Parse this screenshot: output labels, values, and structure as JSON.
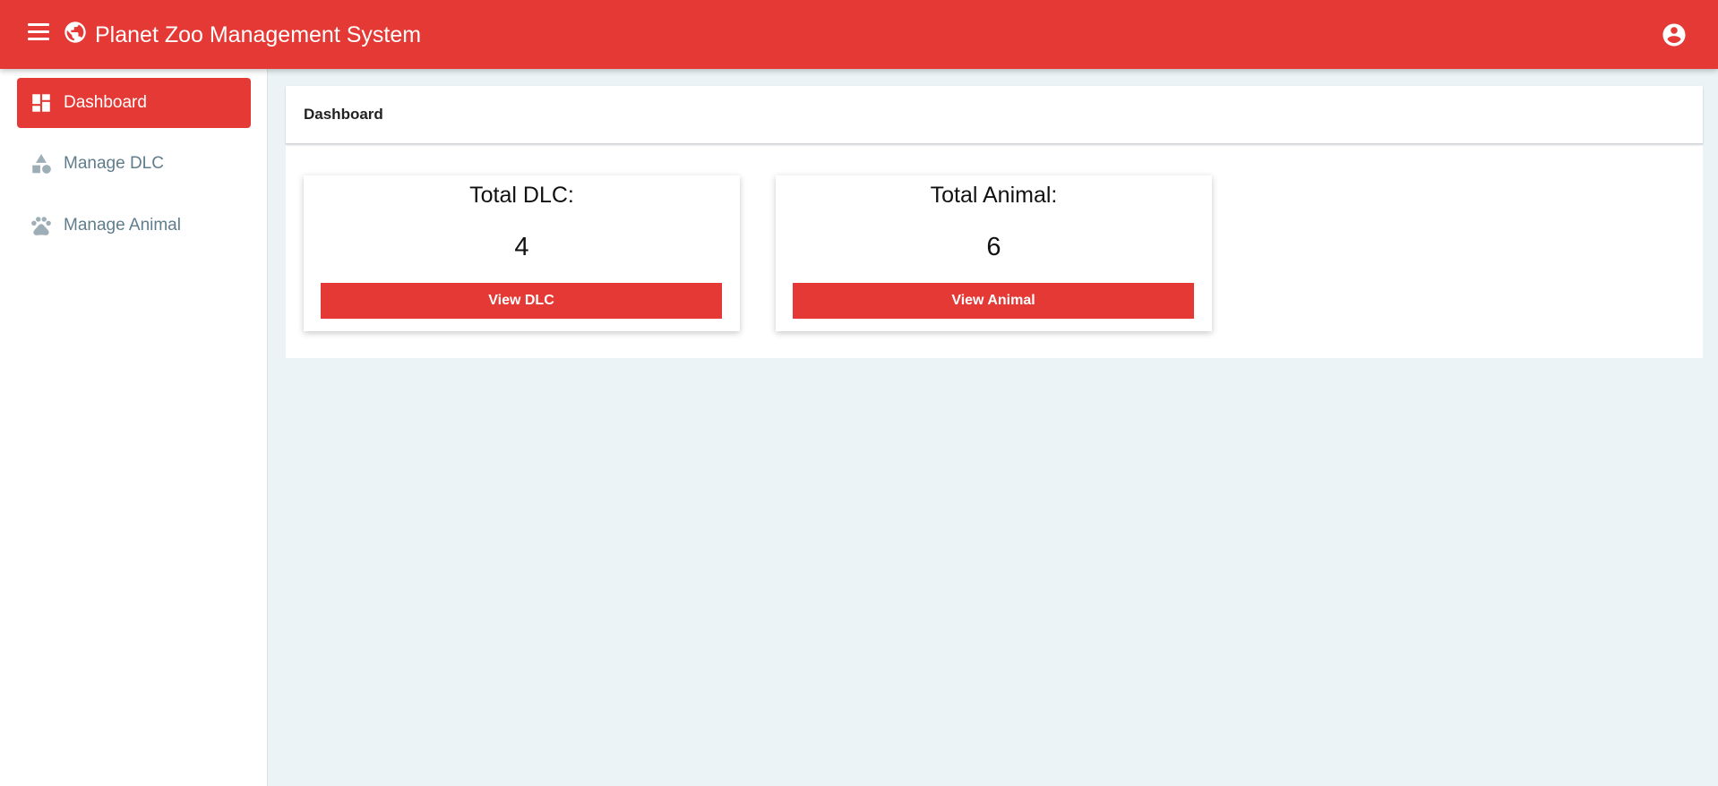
{
  "header": {
    "title": "Planet Zoo Management System",
    "menu_icon": "hamburger-menu-icon",
    "logo_icon": "globe-icon",
    "account_icon": "account-circle-icon",
    "color": "#e53935"
  },
  "sidebar": {
    "items": [
      {
        "label": "Dashboard",
        "icon": "dashboard-icon",
        "active": true
      },
      {
        "label": "Manage DLC",
        "icon": "shapes-icon",
        "active": false
      },
      {
        "label": "Manage Animal",
        "icon": "paw-icon",
        "active": false
      }
    ]
  },
  "main": {
    "header_title": "Dashboard",
    "cards": [
      {
        "label": "Total DLC:",
        "value": "4",
        "button": "View DLC"
      },
      {
        "label": "Total Animal:",
        "value": "6",
        "button": "View Animal"
      }
    ]
  },
  "colors": {
    "accent": "#e53935",
    "background": "#ebf3f6",
    "sidebar_text": "#607d8b"
  }
}
